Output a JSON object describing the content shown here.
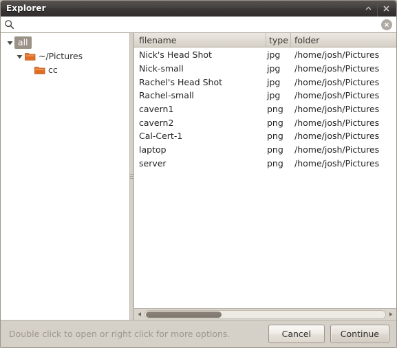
{
  "window": {
    "title": "Explorer",
    "collapse_icon": "chevron-up-icon",
    "close_icon": "close-icon"
  },
  "search": {
    "icon": "search-icon",
    "value": "",
    "placeholder": "",
    "clear_icon": "clear-circle-icon"
  },
  "tree": {
    "items": [
      {
        "label": "all",
        "indent": 0,
        "expanded": true,
        "has_twisty": true,
        "has_folder_icon": false,
        "selected": true
      },
      {
        "label": "~/Pictures",
        "indent": 1,
        "expanded": true,
        "has_twisty": true,
        "has_folder_icon": true,
        "selected": false
      },
      {
        "label": "cc",
        "indent": 2,
        "expanded": false,
        "has_twisty": false,
        "has_folder_icon": true,
        "selected": false
      }
    ]
  },
  "list": {
    "columns": [
      "filename",
      "type",
      "folder"
    ],
    "rows": [
      {
        "filename": "Nick's Head Shot",
        "type": "jpg",
        "folder": "/home/josh/Pictures"
      },
      {
        "filename": "Nick-small",
        "type": "jpg",
        "folder": "/home/josh/Pictures"
      },
      {
        "filename": "Rachel's Head Shot",
        "type": "jpg",
        "folder": "/home/josh/Pictures"
      },
      {
        "filename": "Rachel-small",
        "type": "jpg",
        "folder": "/home/josh/Pictures"
      },
      {
        "filename": "cavern1",
        "type": "png",
        "folder": "/home/josh/Pictures"
      },
      {
        "filename": "cavern2",
        "type": "png",
        "folder": "/home/josh/Pictures"
      },
      {
        "filename": "Cal-Cert-1",
        "type": "png",
        "folder": "/home/josh/Pictures"
      },
      {
        "filename": "laptop",
        "type": "png",
        "folder": "/home/josh/Pictures"
      },
      {
        "filename": "server",
        "type": "png",
        "folder": "/home/josh/Pictures"
      }
    ]
  },
  "scrollbar": {
    "left_arrow_icon": "triangle-left-icon",
    "right_arrow_icon": "triangle-right-icon"
  },
  "footer": {
    "status": "Double click to open or right click for more options.",
    "cancel_label": "Cancel",
    "continue_label": "Continue"
  },
  "colors": {
    "titlebar": "#3b3837",
    "selection": "#9a9187",
    "folder_icon": "#e8762c",
    "window_chrome": "#d5d0c8",
    "status_text": "#9d968d"
  }
}
